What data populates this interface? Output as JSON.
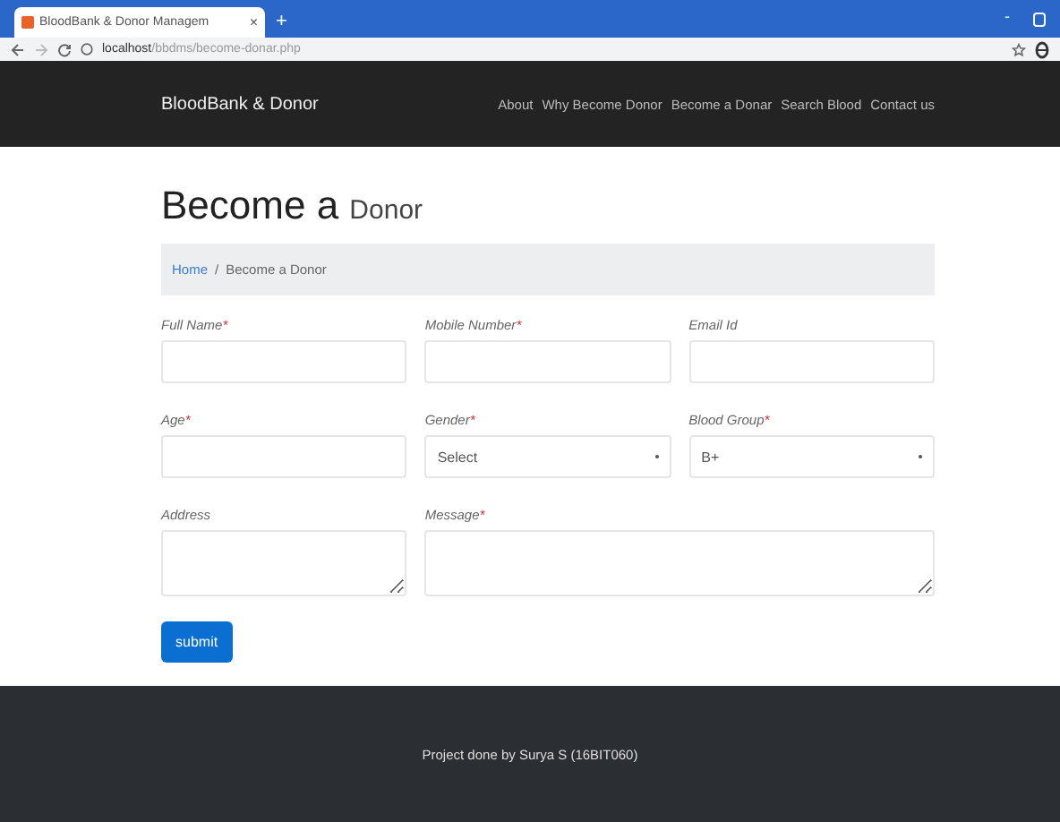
{
  "browser": {
    "tab_title": "BloodBank & Donor Managem",
    "tab_close": "×",
    "new_tab": "+",
    "url_host": "localhost",
    "url_path": "/bbdms/become-donar.php",
    "minimize": "-"
  },
  "navbar": {
    "brand": "BloodBank & Donor",
    "links": [
      "About",
      "Why Become Donor",
      "Become a Donar",
      "Search Blood",
      "Contact us"
    ]
  },
  "heading": {
    "main": "Become a",
    "sub": "Donor"
  },
  "breadcrumb": {
    "home": "Home",
    "separator": "/",
    "current": "Become a Donor"
  },
  "form_rows": [
    [
      {
        "kind": "input",
        "label": "Full Name",
        "mark": "*"
      },
      {
        "kind": "input",
        "label": "Mobile Number",
        "mark": "*"
      },
      {
        "kind": "input",
        "label": "Email Id"
      }
    ],
    [
      {
        "kind": "input",
        "label": "Age",
        "mark": "*"
      },
      {
        "kind": "select",
        "label": "Gender",
        "mark": "*",
        "value": "Select"
      },
      {
        "kind": "select",
        "label": "Blood Group",
        "mark": "*",
        "value": "B+"
      }
    ],
    [
      {
        "kind": "textarea",
        "label": "Address"
      },
      {
        "kind": "textarea",
        "label": "Message",
        "mark": "*"
      }
    ]
  ],
  "submit": "submit",
  "footer": "Project done by Surya S (16BIT060)"
}
